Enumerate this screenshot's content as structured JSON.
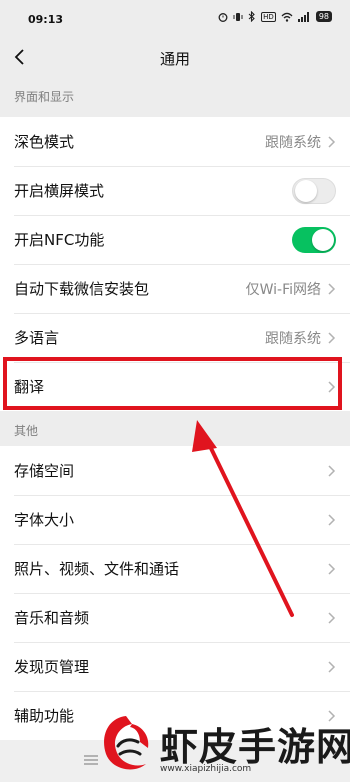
{
  "status_bar": {
    "time": "09:13",
    "network_label": "HD",
    "battery": "98"
  },
  "nav": {
    "title": "通用"
  },
  "sections": [
    {
      "header": "界面和显示",
      "rows": [
        {
          "label": "深色模式",
          "value": "跟随系统",
          "control": "chevron"
        },
        {
          "label": "开启横屏模式",
          "control": "toggle",
          "toggle_on": false
        },
        {
          "label": "开启NFC功能",
          "control": "toggle",
          "toggle_on": true
        },
        {
          "label": "自动下载微信安装包",
          "value": "仅Wi-Fi网络",
          "control": "chevron"
        },
        {
          "label": "多语言",
          "value": "跟随系统",
          "control": "chevron"
        },
        {
          "label": "翻译",
          "control": "chevron"
        }
      ]
    },
    {
      "header": "其他",
      "rows": [
        {
          "label": "存储空间",
          "control": "chevron"
        },
        {
          "label": "字体大小",
          "control": "chevron"
        },
        {
          "label": "照片、视频、文件和通话",
          "control": "chevron"
        },
        {
          "label": "音乐和音频",
          "control": "chevron"
        },
        {
          "label": "发现页管理",
          "control": "chevron"
        },
        {
          "label": "辅助功能",
          "control": "chevron"
        }
      ]
    }
  ],
  "annotation": {
    "color": "#e0141e",
    "highlighted_row": "翻译"
  },
  "toggle_on_color": "#07c160",
  "watermark": {
    "title": "虾皮手游网",
    "url": "www.xiapizhijia.com"
  }
}
